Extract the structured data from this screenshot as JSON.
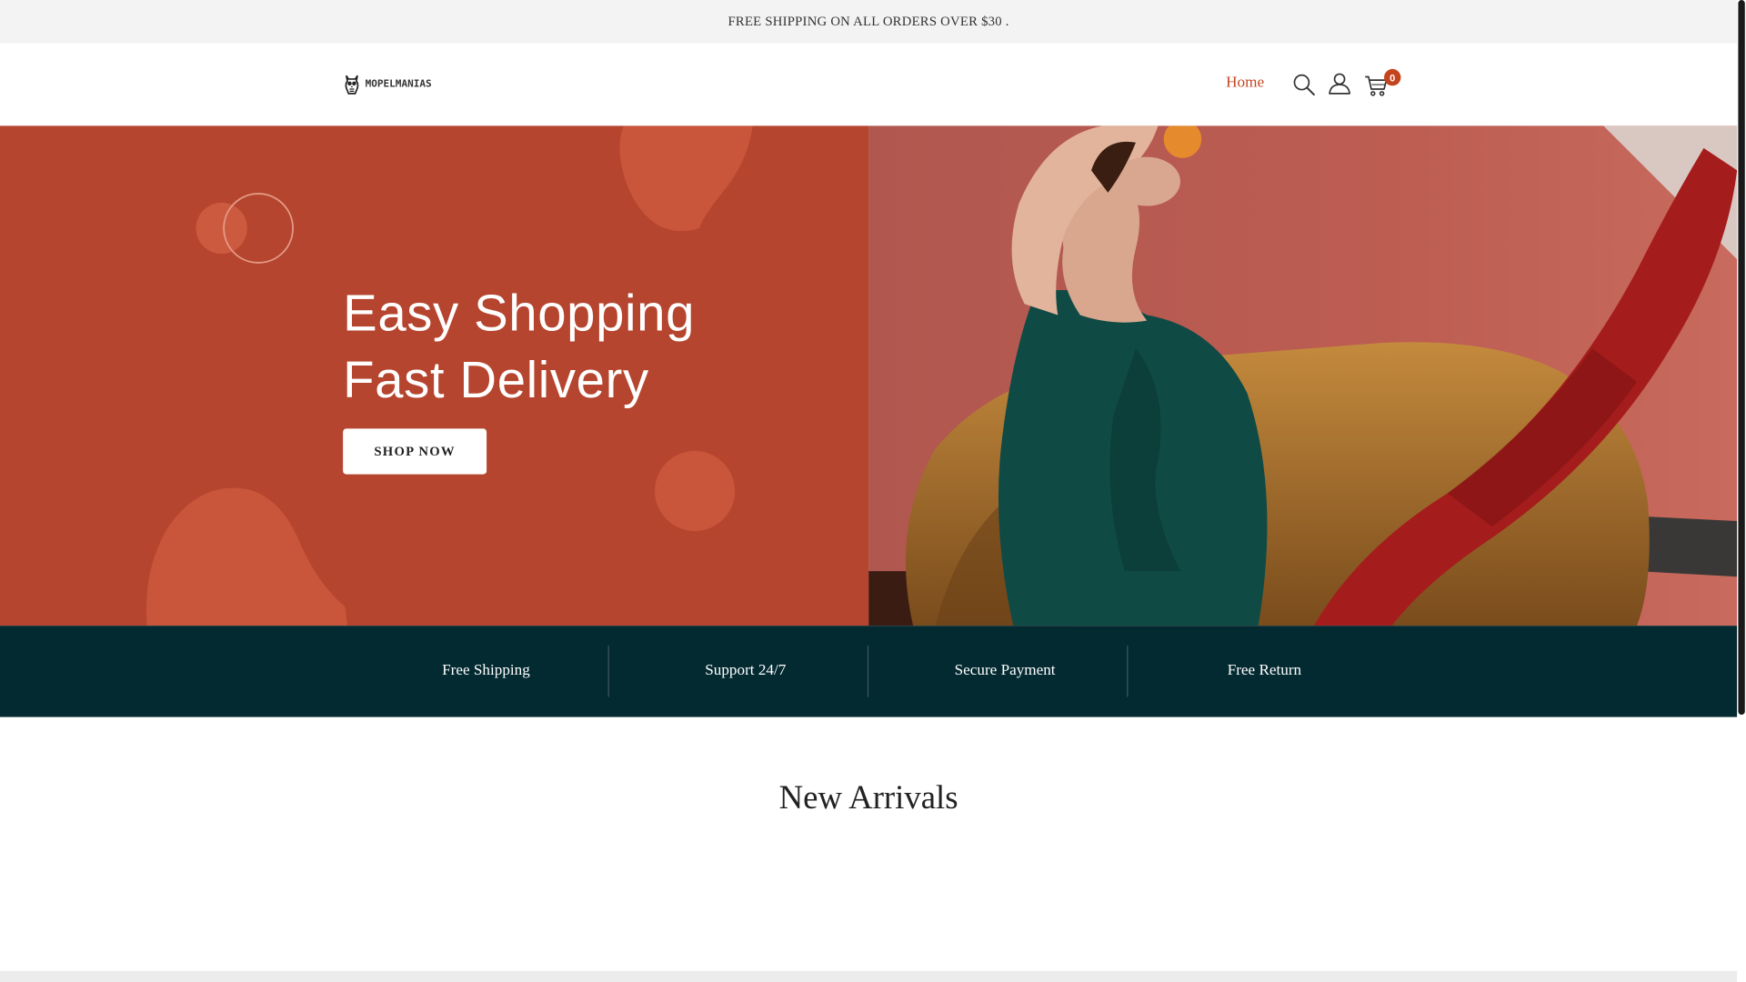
{
  "announcement": "FREE SHIPPING ON ALL ORDERS OVER $30 .",
  "header": {
    "logo_text": "MOPELMANIAS",
    "nav": {
      "home": "Home"
    },
    "icons": {
      "search": "search-icon",
      "account": "user-icon",
      "cart": "cart-icon"
    },
    "cart_count": "0"
  },
  "hero": {
    "title_line1": "Easy Shopping",
    "title_line2": "Fast Delivery",
    "cta": "SHOP NOW",
    "image_alt": "Woman in green top reclining on mustard armchair holding an orange"
  },
  "features": [
    "Free Shipping",
    "Support 24/7",
    "Secure Payment",
    "Free Return"
  ],
  "sections": {
    "new_arrivals": "New Arrivals"
  },
  "colors": {
    "accent": "#c4441e",
    "hero_left_bg": "#b5452e",
    "features_bg": "#032a31",
    "topbar_bg": "#f3f3f3"
  }
}
